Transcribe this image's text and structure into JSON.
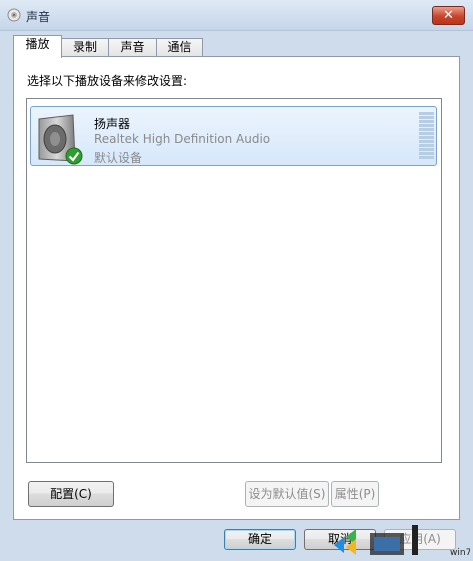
{
  "window": {
    "title": "声音",
    "close_label": "✕"
  },
  "tabs": [
    {
      "label": "播放",
      "active": true
    },
    {
      "label": "录制",
      "active": false
    },
    {
      "label": "声音",
      "active": false
    },
    {
      "label": "通信",
      "active": false
    }
  ],
  "playback": {
    "instruction": "选择以下播放设备来修改设置:",
    "devices": [
      {
        "name": "扬声器",
        "description": "Realtek High Definition Audio",
        "status": "默认设备",
        "icon": "speaker-icon",
        "badge": "default-check-icon"
      }
    ]
  },
  "buttons": {
    "configure": "配置(C)",
    "set_default": "设为默认值(S)",
    "properties": "属性(P)",
    "ok": "确定",
    "cancel": "取消",
    "apply": "应用(A)"
  },
  "watermark": {
    "text": "win7"
  },
  "colors": {
    "selection_border": "#7da2ce",
    "selection_fill": "#d6e8fb",
    "close_button": "#c9452c",
    "check_green": "#2f9e2f"
  }
}
